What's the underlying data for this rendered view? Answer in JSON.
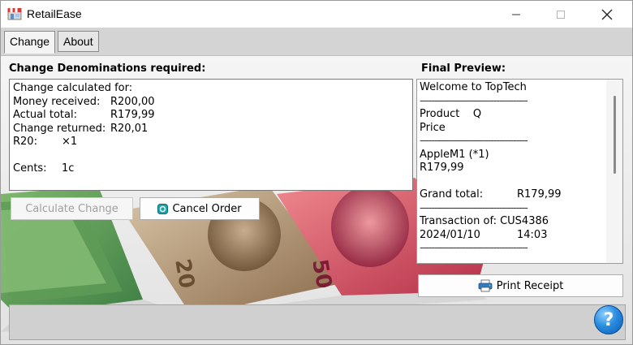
{
  "window": {
    "title": "RetailEase"
  },
  "tabs": [
    {
      "label": "Change"
    },
    {
      "label": "About"
    }
  ],
  "change_panel": {
    "heading": "Change Denominations required:",
    "lines": {
      "calc_for": "Change calculated for:",
      "money_received_label": "Money received:",
      "money_received_value": "R200,00",
      "actual_total_label": "Actual total:",
      "actual_total_value": "R179,99",
      "change_returned_label": "Change returned:",
      "change_returned_value": "R20,01",
      "r20_label": "R20:",
      "r20_value": "×1",
      "cents_label": "Cents:",
      "cents_value": "1c"
    },
    "calculate_button": "Calculate Change",
    "cancel_button": "Cancel Order"
  },
  "preview": {
    "heading": "Final Preview:",
    "welcome": "Welcome to TopTech",
    "separator": "--------------------------------------",
    "product_header": "Product    Q",
    "price_header": "Price",
    "item_name": "AppleM1 (*1)",
    "item_price": "R179,99",
    "grand_total_label": "Grand total:",
    "grand_total_value": "R179,99",
    "transaction_label": "Transaction of: CUS4386",
    "date": "2024/01/10",
    "time": "14:03",
    "print_button": "Print Receipt"
  },
  "help": {
    "symbol": "?"
  },
  "colors": {
    "help_blue": "#2a8de0",
    "note_green": "#4f9a52",
    "note_pink": "#d5556b",
    "note_tan": "#b89a75"
  }
}
